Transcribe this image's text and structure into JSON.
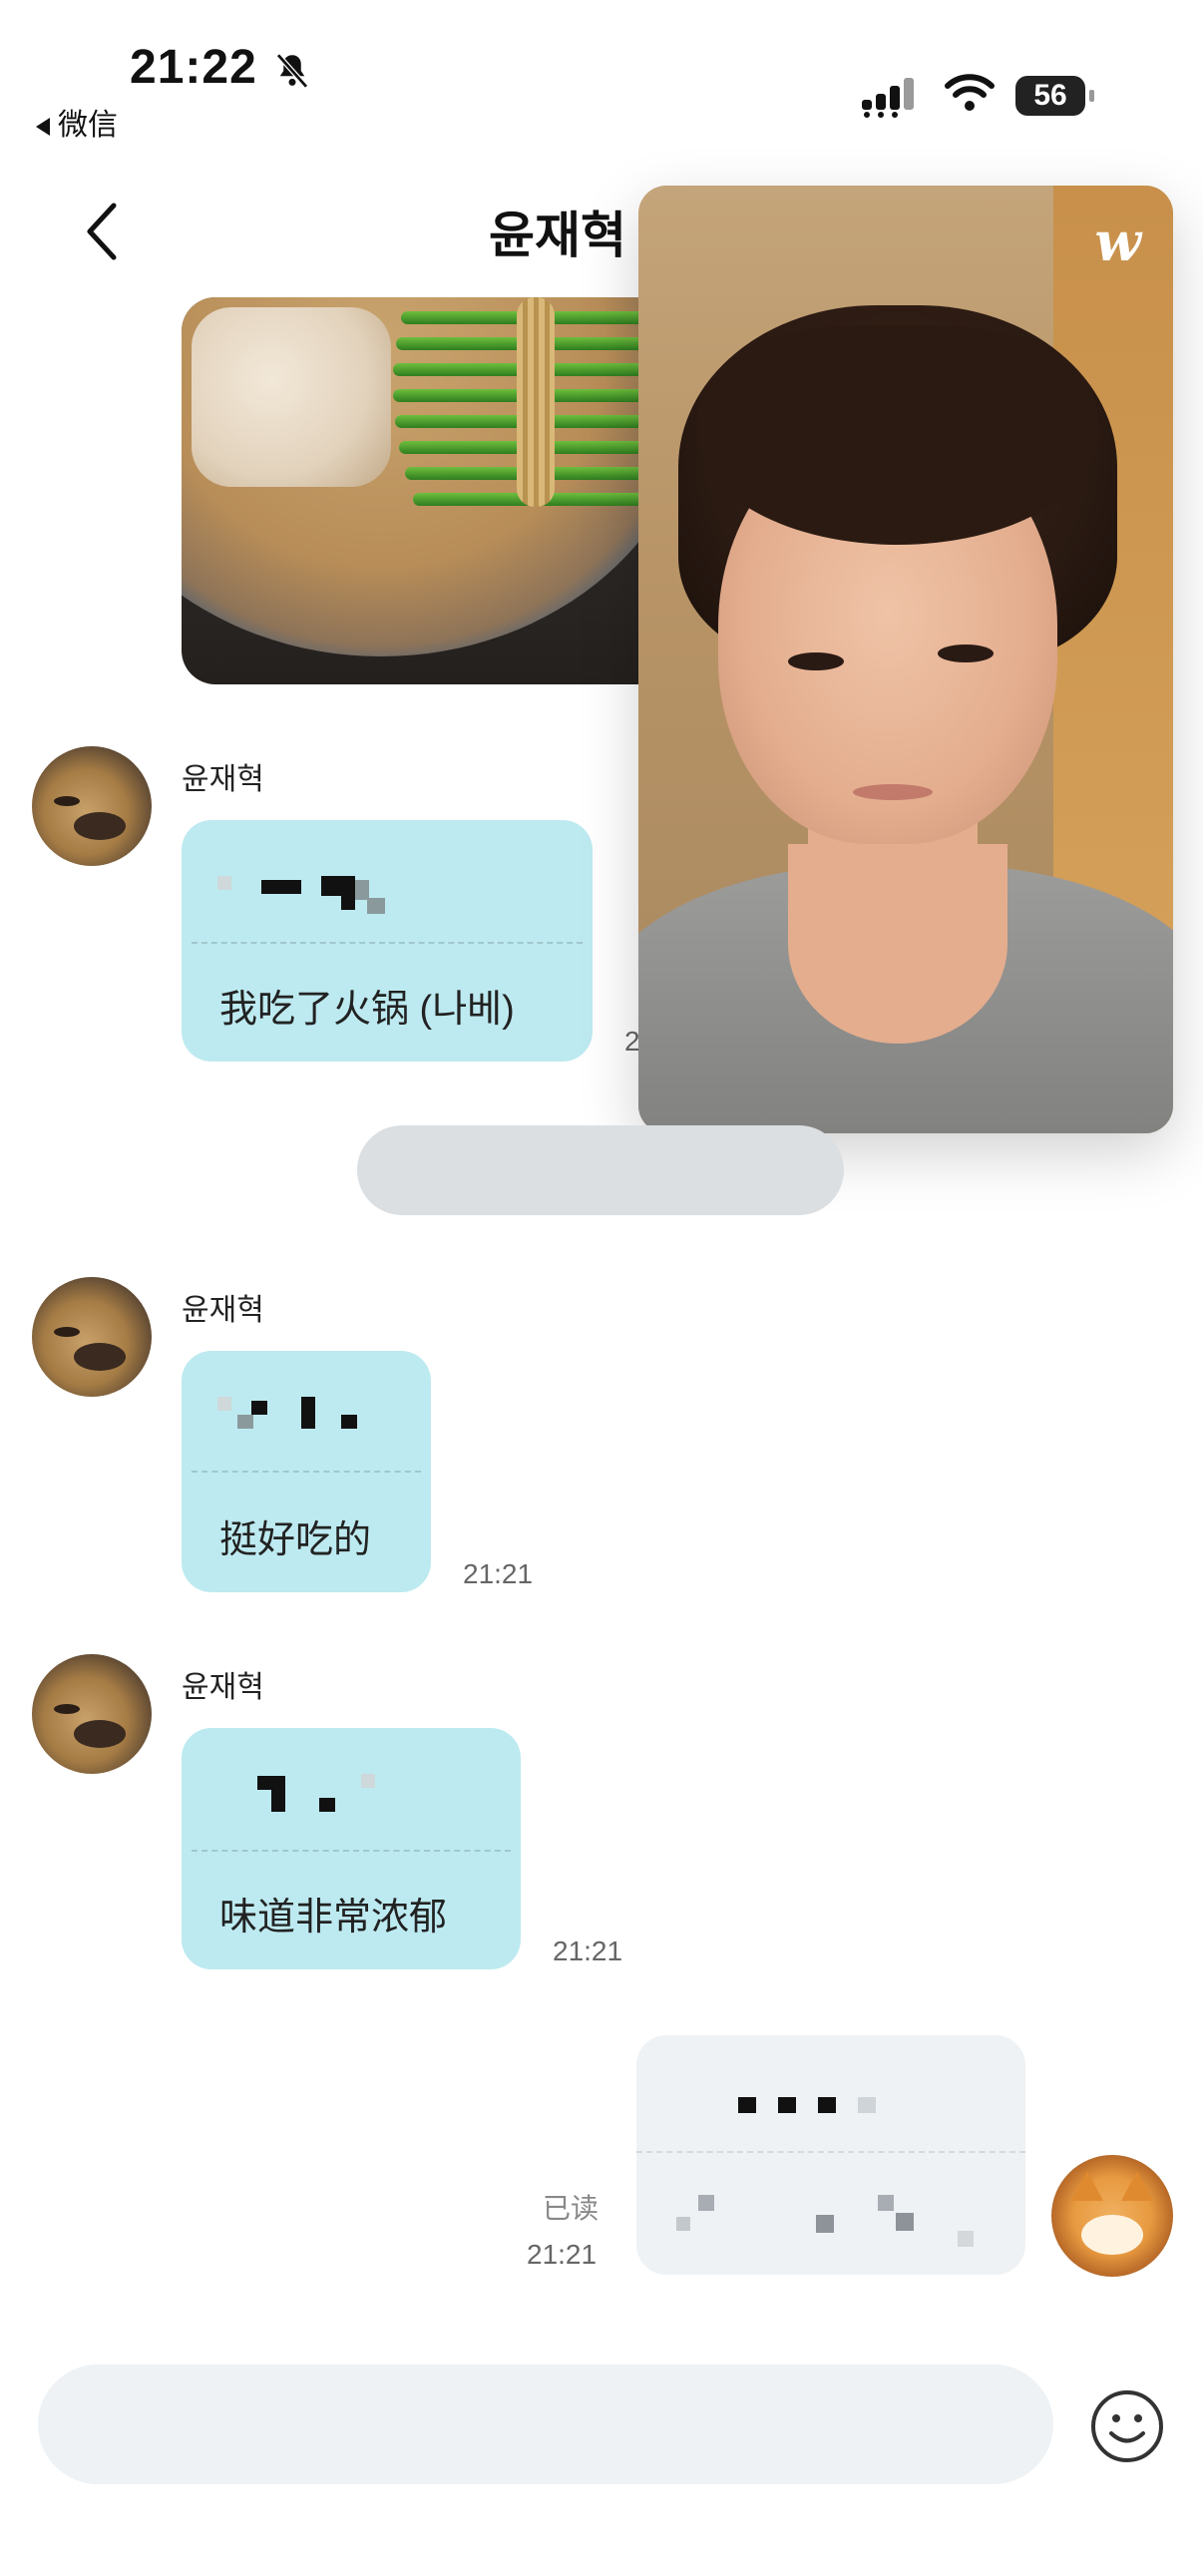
{
  "status_bar": {
    "time": "21:22",
    "back_app_label": "微信",
    "battery": "56",
    "icons": [
      "bell-slash-icon",
      "signal-icon",
      "wifi-icon",
      "battery-icon"
    ]
  },
  "header": {
    "title": "윤재혁",
    "back_icon": "chevron-left-icon"
  },
  "video_overlay": {
    "logo": "w"
  },
  "messages": [
    {
      "type": "image",
      "direction": "incoming"
    },
    {
      "sender": "윤재혁",
      "text": "我吃了火锅 (나베)",
      "time": "2"
    },
    {
      "sender": "윤재혁",
      "text": "挺好吃的",
      "time": "21:21"
    },
    {
      "sender": "윤재혁",
      "text": "味道非常浓郁",
      "time": "21:21"
    },
    {
      "direction": "outgoing",
      "status": "已读",
      "time": "21:21"
    }
  ],
  "input": {
    "emoji_icon": "smiley-icon"
  },
  "colors": {
    "incoming_bubble": "#bdeaf0",
    "outgoing_bubble": "#eef2f5",
    "background": "#ffffff"
  }
}
